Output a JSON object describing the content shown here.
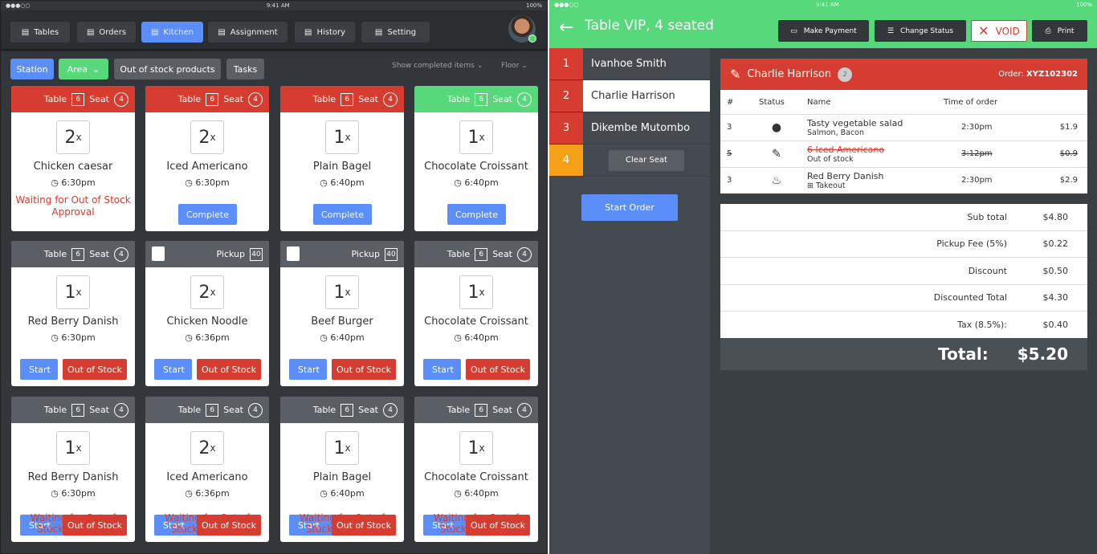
{
  "status_bar": {
    "time": "9:41 AM",
    "battery": "100%"
  },
  "nav": {
    "items": [
      {
        "label": "Tables",
        "icon": "tables-icon"
      },
      {
        "label": "Orders",
        "icon": "orders-icon"
      },
      {
        "label": "Kitchen",
        "icon": "kitchen-icon",
        "active": true
      },
      {
        "label": "Assignment",
        "icon": "assignment-icon"
      },
      {
        "label": "History",
        "icon": "history-icon"
      },
      {
        "label": "Setting",
        "icon": "gear-icon"
      }
    ]
  },
  "filters": {
    "station": "Station",
    "area": "Area",
    "out_of_stock": "Out of stock products",
    "tasks": "Tasks",
    "show_completed": "Show completed items",
    "floor": "Floor"
  },
  "colors": {
    "red": "#d63c2f",
    "green": "#56d87b",
    "gray": "#5a5f66",
    "blue": "#5b8ef9",
    "orange": "#f5a016"
  },
  "cards": [
    {
      "header": "red",
      "type": "Table",
      "table": "6",
      "seat_label": "Seat",
      "seat": "4",
      "qty": "2",
      "name": "Chicken caesar",
      "time": "6:30pm",
      "footer": "waiting",
      "waiting": "Waiting for Out of Stock Approval"
    },
    {
      "header": "red",
      "type": "Table",
      "table": "6",
      "seat_label": "Seat",
      "seat": "4",
      "qty": "2",
      "name": "Iced Americano",
      "time": "6:30pm",
      "footer": "complete",
      "complete": "Complete"
    },
    {
      "header": "red",
      "type": "Table",
      "table": "6",
      "seat_label": "Seat",
      "seat": "4",
      "qty": "1",
      "name": "Plain Bagel",
      "time": "6:40pm",
      "footer": "complete",
      "complete": "Complete"
    },
    {
      "header": "green",
      "type": "Table",
      "table": "6",
      "seat_label": "Seat",
      "seat": "4",
      "qty": "1",
      "name": "Chocolate Croissant",
      "time": "6:40pm",
      "footer": "complete",
      "complete": "Complete"
    },
    {
      "header": "gray",
      "type": "Table",
      "table": "6",
      "seat_label": "Seat",
      "seat": "4",
      "qty": "1",
      "name": "Red Berry Danish",
      "time": "6:30pm",
      "footer": "start",
      "start": "Start",
      "oos": "Out of Stock"
    },
    {
      "header": "gray",
      "type": "Pickup",
      "table": "40",
      "qty": "2",
      "name": "Chicken Noodle",
      "time": "6:36pm",
      "footer": "start",
      "start": "Start",
      "oos": "Out of Stock"
    },
    {
      "header": "gray",
      "type": "Pickup",
      "table": "40",
      "qty": "1",
      "name": "Beef Burger",
      "time": "6:40pm",
      "footer": "start",
      "start": "Start",
      "oos": "Out of Stock"
    },
    {
      "header": "gray",
      "type": "Table",
      "table": "6",
      "seat_label": "Seat",
      "seat": "4",
      "qty": "1",
      "name": "Chocolate Croissant",
      "time": "6:40pm",
      "footer": "start",
      "start": "Start",
      "oos": "Out of Stock"
    },
    {
      "header": "gray",
      "type": "Table",
      "table": "6",
      "seat_label": "Seat",
      "seat": "4",
      "qty": "1",
      "name": "Red Berry Danish",
      "time": "6:30pm",
      "footer": "overlap",
      "start": "Start",
      "oos": "Out of Stock",
      "waiting": "Waiting for Out of Stock Approval"
    },
    {
      "header": "gray",
      "type": "Table",
      "table": "6",
      "seat_label": "Seat",
      "seat": "4",
      "qty": "2",
      "name": "Iced Americano",
      "time": "6:36pm",
      "footer": "overlap",
      "start": "Start",
      "oos": "Out of Stock",
      "waiting": "Waiting for Out of Stock Approval"
    },
    {
      "header": "gray",
      "type": "Table",
      "table": "6",
      "seat_label": "Seat",
      "seat": "4",
      "qty": "1",
      "name": "Plain Bagel",
      "time": "6:40pm",
      "footer": "overlap",
      "start": "Start",
      "oos": "Out of Stock",
      "waiting": "Waiting for Out of Stock Approval"
    },
    {
      "header": "gray",
      "type": "Table",
      "table": "6",
      "seat_label": "Seat",
      "seat": "4",
      "qty": "1",
      "name": "Chocolate Croissant",
      "time": "6:40pm",
      "footer": "overlap",
      "start": "Start",
      "oos": "Out of Stock",
      "waiting": "Waiting for Out of Stock Approval"
    }
  ],
  "right": {
    "title": "Table VIP, 4 seated",
    "actions": {
      "payment": "Make Payment",
      "status": "Change Status",
      "void": "VOID",
      "print": "Print"
    },
    "seats": [
      {
        "num": "1",
        "name": "Ivanhoe Smith"
      },
      {
        "num": "2",
        "name": "Charlie Harrison"
      },
      {
        "num": "3",
        "name": "Dikembe Mutombo"
      },
      {
        "num": "4",
        "name": ""
      }
    ],
    "clear_seat": "Clear Seat",
    "start_order": "Start Order",
    "order": {
      "customer": "Charlie Harrison",
      "badge": "2",
      "order_label": "Order:",
      "order_id": "XYZ102302",
      "columns": [
        "#",
        "Status",
        "Name",
        "Time of order"
      ],
      "rows": [
        {
          "qty": "3",
          "status": "check-icon",
          "name": "Tasty vegetable salad",
          "sub": "Salmon, Bacon",
          "time": "2:30pm",
          "price": "$1.9"
        },
        {
          "qty": "5",
          "status": "edit-icon",
          "name": "6 Iced Americano",
          "sub": "Out of stock",
          "time": "3:12pm",
          "price": "$0.9",
          "struck": true
        },
        {
          "qty": "3",
          "status": "grill-icon",
          "name": "Red Berry Danish",
          "sub": "Takeout",
          "time": "2:30pm",
          "price": "$2.9"
        }
      ]
    },
    "totals": [
      {
        "label": "Sub total",
        "value": "$4.80"
      },
      {
        "label": "Pickup Fee (5%)",
        "value": "$0.22"
      },
      {
        "label": "Discount",
        "value": "$0.50"
      },
      {
        "label": "Discounted Total",
        "value": "$4.30"
      },
      {
        "label": "Tax (8.5%):",
        "value": "$0.40"
      }
    ],
    "total_label": "Total:",
    "total_value": "$5.20"
  }
}
